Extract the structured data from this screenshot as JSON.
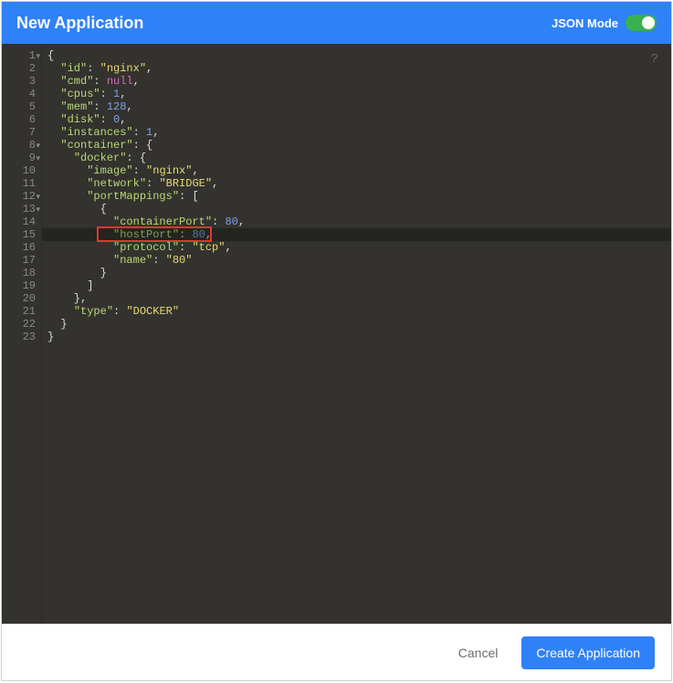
{
  "header": {
    "title": "New Application",
    "json_mode_label": "JSON Mode",
    "json_mode_on": true
  },
  "help_icon": "?",
  "footer": {
    "cancel_label": "Cancel",
    "create_label": "Create Application"
  },
  "editor": {
    "highlighted_line": 15,
    "red_box_line": 15,
    "line_count": 23,
    "fold_markers": [
      1,
      8,
      9,
      12,
      13
    ],
    "json_content": {
      "id": "nginx",
      "cmd": null,
      "cpus": 1,
      "mem": 128,
      "disk": 0,
      "instances": 1,
      "container": {
        "docker": {
          "image": "nginx",
          "network": "BRIDGE",
          "portMappings": [
            {
              "containerPort": 80,
              "hostPort": 80,
              "protocol": "tcp",
              "name": "80"
            }
          ]
        },
        "type": "DOCKER"
      }
    },
    "tokens": [
      [
        [
          "pun",
          "{"
        ]
      ],
      [
        [
          "pun",
          "  "
        ],
        [
          "key",
          "\"id\""
        ],
        [
          "pun",
          ": "
        ],
        [
          "str",
          "\"nginx\""
        ],
        [
          "pun",
          ","
        ]
      ],
      [
        [
          "pun",
          "  "
        ],
        [
          "key",
          "\"cmd\""
        ],
        [
          "pun",
          ": "
        ],
        [
          "null",
          "null"
        ],
        [
          "pun",
          ","
        ]
      ],
      [
        [
          "pun",
          "  "
        ],
        [
          "key",
          "\"cpus\""
        ],
        [
          "pun",
          ": "
        ],
        [
          "num",
          "1"
        ],
        [
          "pun",
          ","
        ]
      ],
      [
        [
          "pun",
          "  "
        ],
        [
          "key",
          "\"mem\""
        ],
        [
          "pun",
          ": "
        ],
        [
          "num",
          "128"
        ],
        [
          "pun",
          ","
        ]
      ],
      [
        [
          "pun",
          "  "
        ],
        [
          "key",
          "\"disk\""
        ],
        [
          "pun",
          ": "
        ],
        [
          "num",
          "0"
        ],
        [
          "pun",
          ","
        ]
      ],
      [
        [
          "pun",
          "  "
        ],
        [
          "key",
          "\"instances\""
        ],
        [
          "pun",
          ": "
        ],
        [
          "num",
          "1"
        ],
        [
          "pun",
          ","
        ]
      ],
      [
        [
          "pun",
          "  "
        ],
        [
          "key",
          "\"container\""
        ],
        [
          "pun",
          ": {"
        ]
      ],
      [
        [
          "pun",
          "    "
        ],
        [
          "key",
          "\"docker\""
        ],
        [
          "pun",
          ": {"
        ]
      ],
      [
        [
          "pun",
          "      "
        ],
        [
          "key",
          "\"image\""
        ],
        [
          "pun",
          ": "
        ],
        [
          "str",
          "\"nginx\""
        ],
        [
          "pun",
          ","
        ]
      ],
      [
        [
          "pun",
          "      "
        ],
        [
          "key",
          "\"network\""
        ],
        [
          "pun",
          ": "
        ],
        [
          "str",
          "\"BRIDGE\""
        ],
        [
          "pun",
          ","
        ]
      ],
      [
        [
          "pun",
          "      "
        ],
        [
          "key",
          "\"portMappings\""
        ],
        [
          "pun",
          ": ["
        ]
      ],
      [
        [
          "pun",
          "        {"
        ]
      ],
      [
        [
          "pun",
          "          "
        ],
        [
          "key",
          "\"containerPort\""
        ],
        [
          "pun",
          ": "
        ],
        [
          "num",
          "80"
        ],
        [
          "pun",
          ","
        ]
      ],
      [
        [
          "pun",
          "          "
        ],
        [
          "key",
          "\"hostPort\""
        ],
        [
          "pun",
          ": "
        ],
        [
          "num",
          "80"
        ],
        [
          "pun",
          ","
        ]
      ],
      [
        [
          "pun",
          "          "
        ],
        [
          "key",
          "\"protocol\""
        ],
        [
          "pun",
          ": "
        ],
        [
          "str",
          "\"tcp\""
        ],
        [
          "pun",
          ","
        ]
      ],
      [
        [
          "pun",
          "          "
        ],
        [
          "key",
          "\"name\""
        ],
        [
          "pun",
          ": "
        ],
        [
          "str",
          "\"80\""
        ]
      ],
      [
        [
          "pun",
          "        }"
        ]
      ],
      [
        [
          "pun",
          "      ]"
        ]
      ],
      [
        [
          "pun",
          "    },"
        ]
      ],
      [
        [
          "pun",
          "    "
        ],
        [
          "key",
          "\"type\""
        ],
        [
          "pun",
          ": "
        ],
        [
          "str",
          "\"DOCKER\""
        ]
      ],
      [
        [
          "pun",
          "  }"
        ]
      ],
      [
        [
          "pun",
          "}"
        ]
      ]
    ]
  }
}
